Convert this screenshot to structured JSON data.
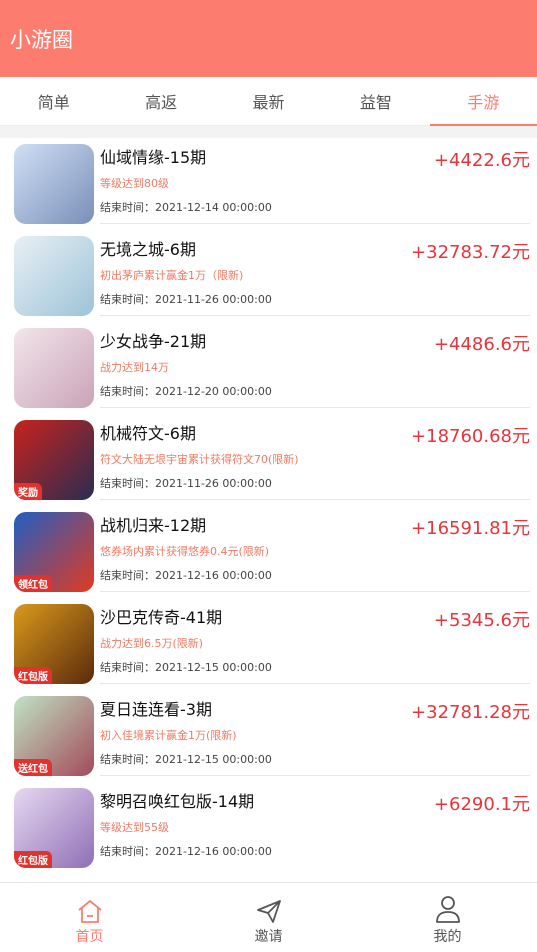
{
  "header": {
    "title": "小游圈"
  },
  "tabs": [
    {
      "label": "简单",
      "active": false
    },
    {
      "label": "高返",
      "active": false
    },
    {
      "label": "最新",
      "active": false
    },
    {
      "label": "益智",
      "active": false
    },
    {
      "label": "手游",
      "active": true
    }
  ],
  "games": [
    {
      "name": "仙域情缘-15期",
      "reward": "+4422.6元",
      "condition": "等级达到80级",
      "end_label": "结束时间：",
      "end_time": "2021-12-14 00:00:00",
      "colors": [
        "#cfe0f5",
        "#7a8fb8"
      ],
      "badge": ""
    },
    {
      "name": "无境之城-6期",
      "reward": "+32783.72元",
      "condition": "初出茅庐累计赢金1万（限新)",
      "end_label": "结束时间：",
      "end_time": "2021-11-26 00:00:00",
      "colors": [
        "#e8f0f4",
        "#9dc3d8"
      ],
      "badge": ""
    },
    {
      "name": "少女战争-21期",
      "reward": "+4486.6元",
      "condition": "战力达到14万",
      "end_label": "结束时间：",
      "end_time": "2021-12-20 00:00:00",
      "colors": [
        "#f2e6ea",
        "#c9a3b8"
      ],
      "badge": ""
    },
    {
      "name": "机械符文-6期",
      "reward": "+18760.68元",
      "condition": "符文大陆无垠宇宙累计获得符文70(限新)",
      "end_label": "结束时间：",
      "end_time": "2021-11-26 00:00:00",
      "colors": [
        "#c7231c",
        "#2a2c52"
      ],
      "badge": "奖励"
    },
    {
      "name": "战机归来-12期",
      "reward": "+16591.81元",
      "condition": "悠券场内累计获得悠券0.4元(限新)",
      "end_label": "结束时间：",
      "end_time": "2021-12-16 00:00:00",
      "colors": [
        "#1f5fc4",
        "#e13a1e"
      ],
      "badge": "领红包"
    },
    {
      "name": "沙巴克传奇-41期",
      "reward": "+5345.6元",
      "condition": "战力达到6.5万(限新)",
      "end_label": "结束时间：",
      "end_time": "2021-12-15 00:00:00",
      "colors": [
        "#d99a1c",
        "#5a2a0c"
      ],
      "badge": "红包版"
    },
    {
      "name": "夏日连连看-3期",
      "reward": "+32781.28元",
      "condition": "初入佳境累计赢金1万(限新)",
      "end_label": "结束时间：",
      "end_time": "2021-12-15 00:00:00",
      "colors": [
        "#bfe3c4",
        "#a34a5a"
      ],
      "badge": "送红包"
    },
    {
      "name": "黎明召唤红包版-14期",
      "reward": "+6290.1元",
      "condition": "等级达到55级",
      "end_label": "结束时间：",
      "end_time": "2021-12-16 00:00:00",
      "colors": [
        "#e6d8f2",
        "#8f6fb5"
      ],
      "badge": "红包版"
    }
  ],
  "bottom_nav": [
    {
      "label": "首页",
      "icon": "home-icon",
      "active": true
    },
    {
      "label": "邀请",
      "icon": "paper-plane-icon",
      "active": false
    },
    {
      "label": "我的",
      "icon": "user-icon",
      "active": false
    }
  ],
  "accent_color": "#fc7d6f",
  "reward_color": "#e8343a"
}
